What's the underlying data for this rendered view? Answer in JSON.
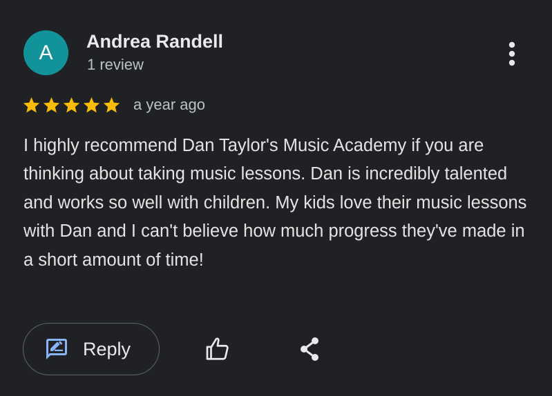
{
  "review": {
    "author": {
      "initial": "A",
      "name": "Andrea Randell",
      "review_count": "1 review",
      "avatar_color": "#12939a"
    },
    "rating": 5,
    "max_rating": 5,
    "star_color": "#fbbc04",
    "timestamp": "a year ago",
    "text": "I highly recommend Dan Taylor's Music Academy if you are thinking about taking music lessons. Dan is incredibly talented and works so well with children. My kids love their music lessons with Dan and I can't believe how much progress they've made in a short amount of time!",
    "menu_icon": "more-vert-icon"
  },
  "actions": {
    "reply_label": "Reply",
    "reply_icon": "rate-review-icon",
    "like_icon": "thumb-up-icon",
    "share_icon": "share-icon",
    "accent_color": "#8ab4f8"
  }
}
